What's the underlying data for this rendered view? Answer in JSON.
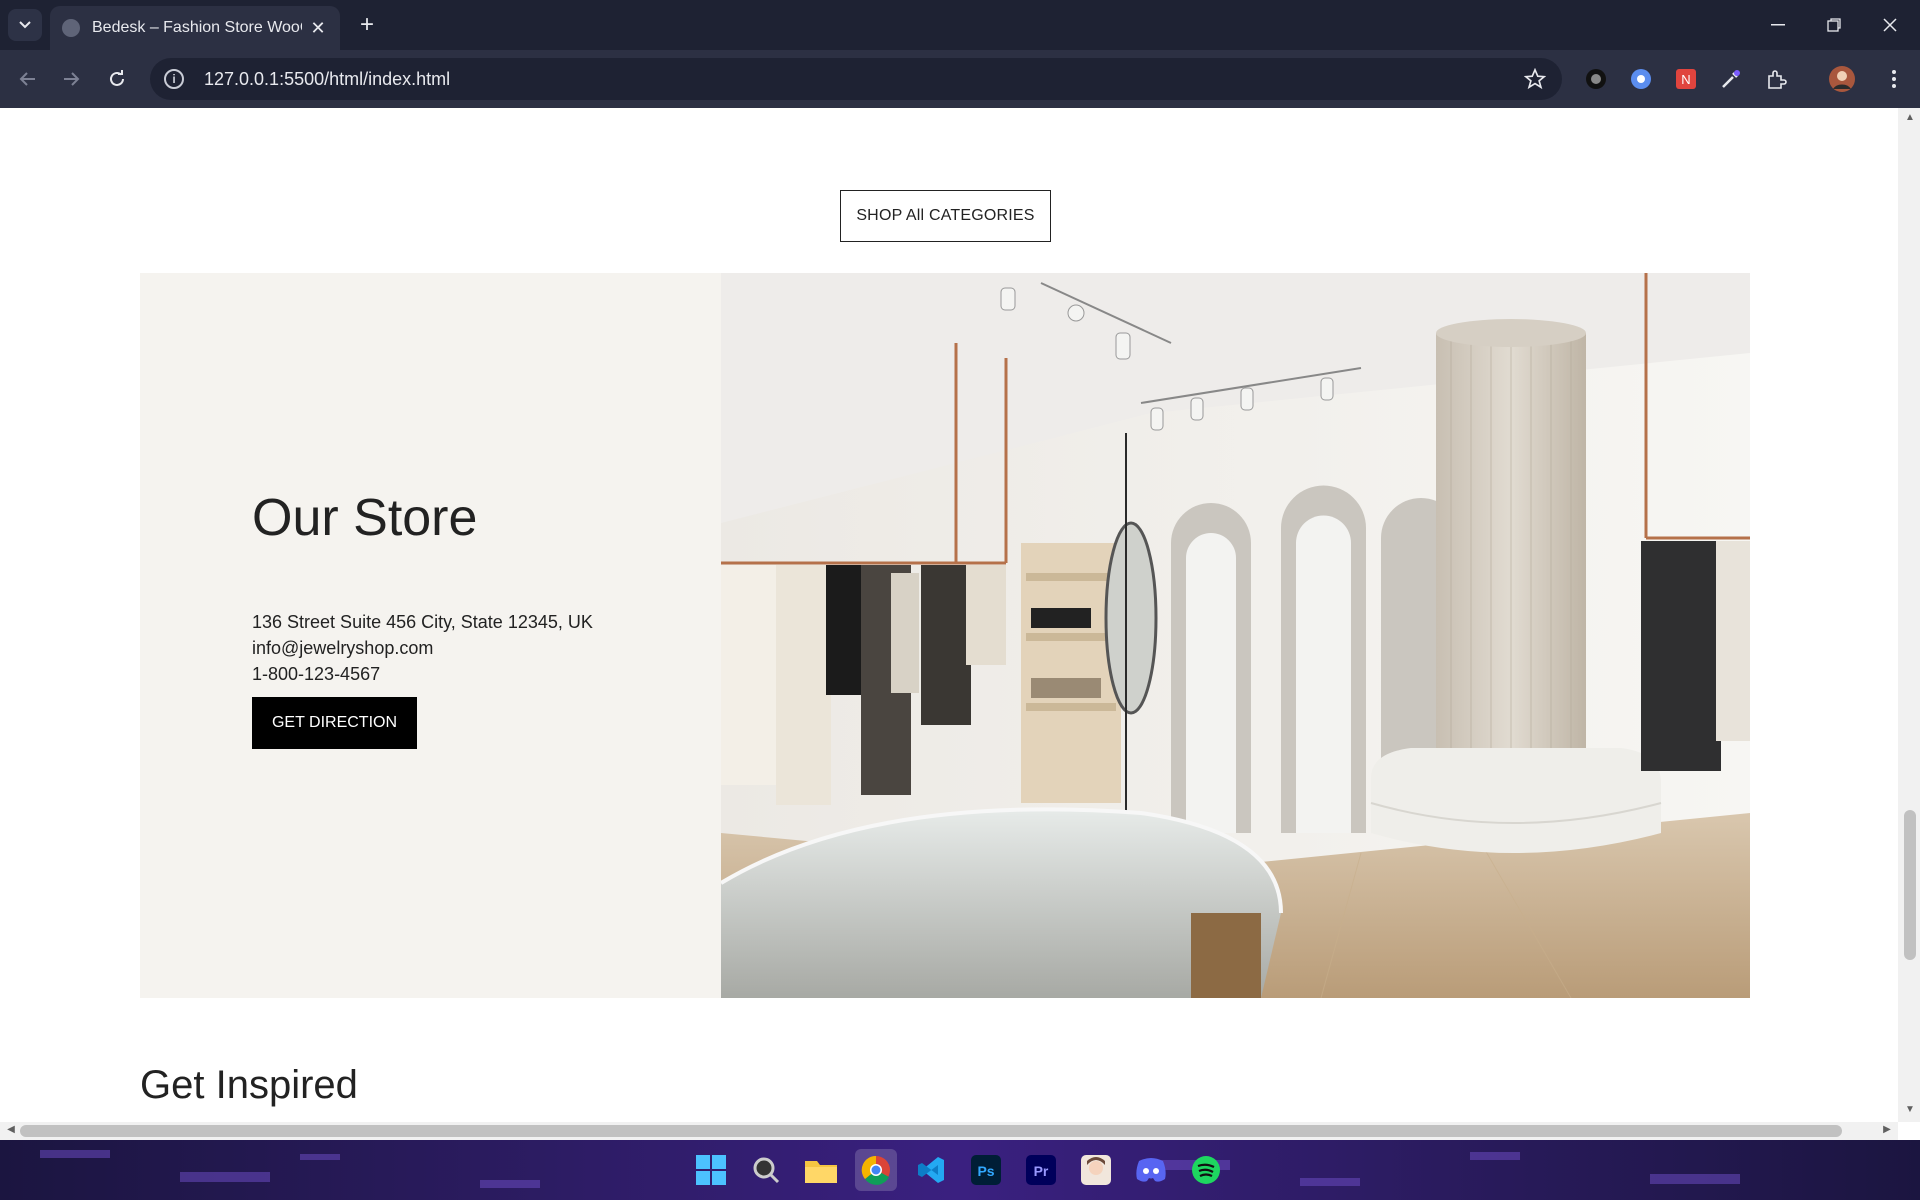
{
  "browser": {
    "tab_title": "Bedesk – Fashion Store WooCo",
    "url": "127.0.0.1:5500/html/index.html",
    "new_tab_symbol": "+",
    "tab_close_symbol": "✕"
  },
  "page": {
    "shop_all_label": "SHOP All CATEGORIES",
    "store": {
      "title": "Our Store",
      "address": "136 Street Suite 456 City, State 12345, UK",
      "email": "info@jewelryshop.com",
      "phone": "1-800-123-4567",
      "direction_label": "GET DIRECTION"
    },
    "inspired_title": "Get Inspired"
  },
  "taskbar": {
    "apps": [
      "windows-start",
      "search",
      "file-explorer",
      "chrome",
      "vscode",
      "photoshop",
      "premiere",
      "anime-app",
      "discord",
      "spotify"
    ],
    "ps_label": "Ps",
    "pr_label": "Pr"
  },
  "colors": {
    "chrome_dark": "#1e2233",
    "chrome_toolbar": "#2c3043",
    "store_bg": "#f5f3ef",
    "button_black": "#000000"
  }
}
